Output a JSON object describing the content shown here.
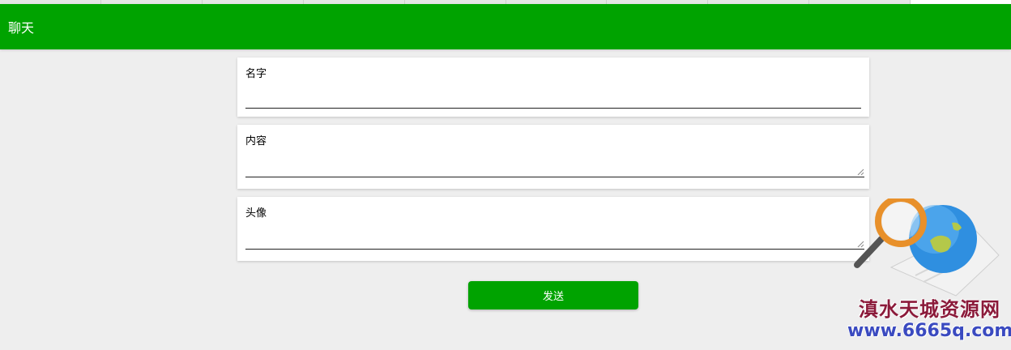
{
  "header": {
    "title": "聊天",
    "color": "#00a300"
  },
  "form": {
    "name_label": "名字",
    "name_value": "",
    "content_label": "内容",
    "content_value": "",
    "avatar_label": "头像",
    "avatar_value": ""
  },
  "actions": {
    "send_label": "发送"
  },
  "watermark": {
    "site_name": "滇水天城资源网",
    "url": "www.6665q.com"
  }
}
